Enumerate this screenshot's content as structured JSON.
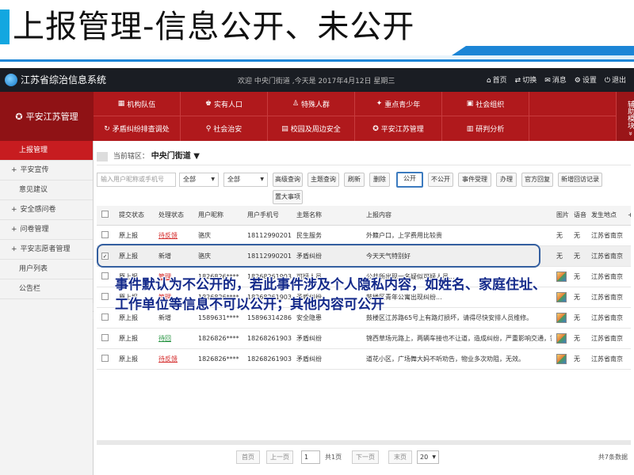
{
  "slide": {
    "title": "上报管理-信息公开、未公开"
  },
  "app": {
    "system_name": "江苏省综治信息系统",
    "welcome": "欢迎 中央门街道 ,今天是 2017年4月12日 星期三",
    "menu": [
      {
        "icon": "home-icon",
        "glyph": "⌂",
        "label": "首页"
      },
      {
        "icon": "switch-icon",
        "glyph": "⇄",
        "label": "切换"
      },
      {
        "icon": "mail-icon",
        "glyph": "✉",
        "label": "消息"
      },
      {
        "icon": "gear-icon",
        "glyph": "⚙",
        "label": "设置"
      },
      {
        "icon": "power-icon",
        "glyph": "⏻",
        "label": "退出"
      }
    ]
  },
  "modules": {
    "home": "平安江苏管理",
    "row1": [
      {
        "icon": "building-icon",
        "glyph": "▦",
        "label": "机构队伍"
      },
      {
        "icon": "people-icon",
        "glyph": "♚",
        "label": "实有人口"
      },
      {
        "icon": "person-icon",
        "glyph": "♙",
        "label": "特殊人群"
      },
      {
        "icon": "runner-icon",
        "glyph": "✦",
        "label": "重点青少年"
      },
      {
        "icon": "org-icon",
        "glyph": "▣",
        "label": "社会组织"
      },
      {
        "icon": "",
        "glyph": "",
        "label": ""
      }
    ],
    "row2": [
      {
        "icon": "refresh-icon",
        "glyph": "↻",
        "label": "矛盾纠纷排查调处"
      },
      {
        "icon": "shield-icon",
        "glyph": "⚲",
        "label": "社会治安"
      },
      {
        "icon": "school-icon",
        "glyph": "▤",
        "label": "校园及周边安全"
      },
      {
        "icon": "flag-icon",
        "glyph": "✪",
        "label": "平安江苏管理"
      },
      {
        "icon": "chart-icon",
        "glyph": "▥",
        "label": "研判分析"
      },
      {
        "icon": "",
        "glyph": "",
        "label": ""
      }
    ],
    "aux": "辅助模块 »"
  },
  "sidebar": {
    "items": [
      {
        "label": "上报管理",
        "plus": false,
        "active": true
      },
      {
        "label": "平安宣传",
        "plus": true,
        "active": false
      },
      {
        "label": "意见建议",
        "plus": false,
        "active": false
      },
      {
        "label": "安全感问卷",
        "plus": true,
        "active": false
      },
      {
        "label": "问卷管理",
        "plus": true,
        "active": false
      },
      {
        "label": "平安志愿者管理",
        "plus": true,
        "active": false
      },
      {
        "label": "用户列表",
        "plus": false,
        "active": false
      },
      {
        "label": "公告栏",
        "plus": false,
        "active": false
      }
    ]
  },
  "content": {
    "region_label": "当前辖区：",
    "region_value": "中央门街道 ▼",
    "search_placeholder": "输入用户昵称或手机号",
    "select1": "全部",
    "select2": "全部",
    "buttons": [
      "高级查询",
      "主题查询",
      "刷新",
      "删除",
      "公开",
      "不公开",
      "事件受理",
      "办理",
      "官方回复",
      "新增回访记录",
      "置大事项"
    ],
    "columns": [
      "",
      "提交状态",
      "处理状态",
      "用户昵称",
      "用户手机号",
      "主题名称",
      "上报内容",
      "图片",
      "语音",
      "发生地点",
      "+"
    ],
    "rows": [
      {
        "checked": false,
        "submit": "原上报",
        "process": "待反馈",
        "pcolor": "red",
        "nick": "骆庆",
        "phone": "18112990201",
        "topic": "民生服务",
        "content": "外籍户口，上学费用比较贵",
        "pic": "无",
        "voice": "无",
        "place": "江苏省南京市鼓"
      },
      {
        "checked": true,
        "submit": "原上报",
        "process": "新增",
        "pcolor": "plain",
        "nick": "骆庆",
        "phone": "18112990201",
        "topic": "矛盾纠纷",
        "content": "今天天气特别好",
        "pic": "无",
        "voice": "无",
        "place": "江苏省南京市鼓"
      },
      {
        "checked": false,
        "submit": "原上报",
        "process": "管理",
        "pcolor": "red",
        "nick": "1826826****",
        "phone": "18268261903",
        "topic": "可疑人员",
        "content": "公共所出现一名疑似可疑人员...",
        "pic": "img",
        "voice": "无",
        "place": "江苏省南京市鼓"
      },
      {
        "checked": false,
        "submit": "原上报",
        "process": "管理",
        "pcolor": "red",
        "nick": "1826826****",
        "phone": "18268261903",
        "topic": "矛盾纠纷",
        "content": "鼓楼区青年公寓出现纠纷...",
        "pic": "img",
        "voice": "无",
        "place": "江苏省南京市鼓"
      },
      {
        "checked": false,
        "submit": "原上报",
        "process": "新增",
        "pcolor": "plain",
        "nick": "1589631****",
        "phone": "15896314286",
        "topic": "安全隐患",
        "content": "鼓楼区江苏路65号上有路灯损坏，请得尽快安排人员维修。",
        "pic": "img",
        "voice": "无",
        "place": "江苏省南京市鼓"
      },
      {
        "checked": false,
        "submit": "原上报",
        "process": "待回",
        "pcolor": "green",
        "nick": "1826826****",
        "phone": "18268261903",
        "topic": "矛盾纠纷",
        "content": "锦西草场元路上，两辆车接也不让道，造成纠纷，严重影响交通，需要及时",
        "pic": "img",
        "voice": "无",
        "place": "江苏省南京市鼓"
      },
      {
        "checked": false,
        "submit": "原上报",
        "process": "待反馈",
        "pcolor": "red",
        "nick": "1826826****",
        "phone": "18268261903",
        "topic": "矛盾纠纷",
        "content": "道花小区，广场舞大妈不听劝告，物业多次劝阻，无效。",
        "pic": "img",
        "voice": "无",
        "place": "江苏省南京市鼓"
      }
    ],
    "overlay_text": "事件默认为不公开的，若此事件涉及个人隐私内容，如姓名、家庭住址、工作单位等信息不可以公开；其他内容可公开"
  },
  "pager": {
    "first": "首页",
    "prev": "上一页",
    "page": "1",
    "total_pages": "共1页",
    "next": "下一页",
    "last": "末页",
    "page_size": "20",
    "total_records": "共7条数据"
  }
}
